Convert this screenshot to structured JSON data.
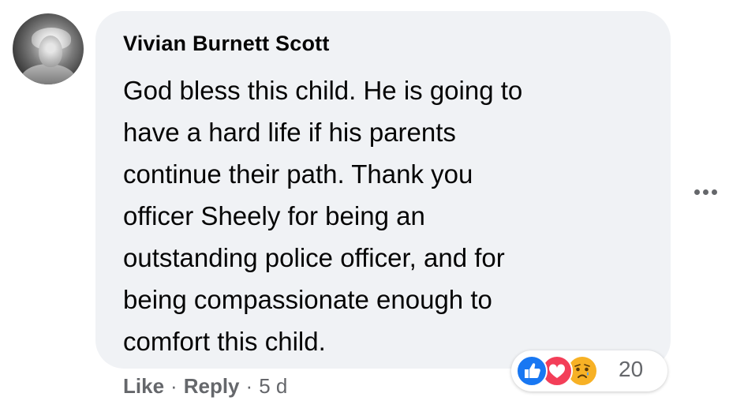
{
  "comment": {
    "author": "Vivian Burnett Scott",
    "text_lines": [
      "God bless this child. He is going to",
      "have a hard life if his parents",
      "continue their path. Thank you",
      "officer Sheely for being an",
      "outstanding police officer, and for",
      "being compassionate enough to",
      "comfort this child."
    ],
    "actions": {
      "like_label": "Like",
      "separator": "·",
      "reply_label": "Reply",
      "time": "5 d"
    },
    "reactions": {
      "icons": [
        "like-icon",
        "love-icon",
        "sad-icon"
      ],
      "count": "20"
    }
  },
  "more_options_icon": "more-horizontal-icon",
  "colors": {
    "bubble": "#f0f2f5",
    "text": "#050505",
    "secondary_text": "#65676b",
    "like": "#1877f2",
    "love": "#f33e58",
    "sad": "#f7b125"
  }
}
